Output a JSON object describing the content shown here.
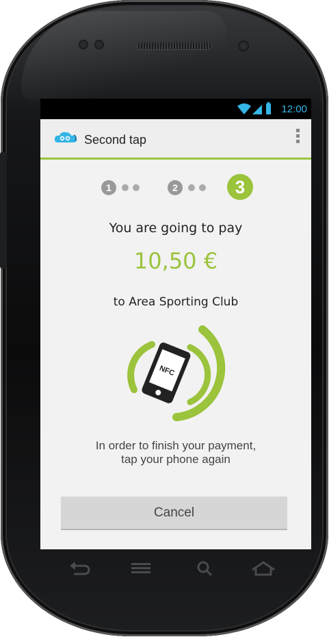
{
  "status_bar": {
    "time": "12:00",
    "icons": [
      "wifi-icon",
      "signal-icon",
      "battery-icon"
    ],
    "accent": "#33b5e5"
  },
  "action_bar": {
    "title": "Second tap",
    "logo": "cloud-logo-icon",
    "menu": "overflow-menu-icon",
    "accent": "#9bc33c"
  },
  "steps": {
    "items": [
      "1",
      "2",
      "3"
    ],
    "active": "3",
    "active_color": "#9bc33c",
    "inactive_color": "#999999"
  },
  "payment": {
    "intro": "You are going to pay",
    "amount": "10,50 €",
    "merchant": "to Area Sporting Club",
    "nfc_label": "NFC",
    "instruction_line1": "In order to finish your payment,",
    "instruction_line2": "tap your phone again"
  },
  "cancel_button": {
    "label": "Cancel"
  },
  "nav_bar": {
    "icons": [
      "back-icon",
      "menu-icon",
      "search-icon",
      "home-icon"
    ]
  }
}
